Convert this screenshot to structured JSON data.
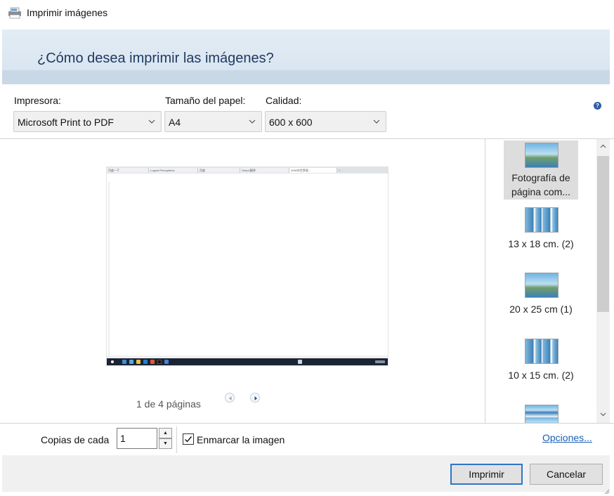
{
  "window": {
    "title": "Imprimir imágenes"
  },
  "header": {
    "title": "¿Cómo desea imprimir las imágenes?"
  },
  "printer": {
    "label": "Impresora:",
    "value": "Microsoft Print to PDF"
  },
  "paper": {
    "label": "Tamaño del papel:",
    "value": "A4"
  },
  "quality": {
    "label": "Calidad:",
    "value": "600 x 600"
  },
  "help": {
    "glyph": "?"
  },
  "preview": {
    "tabs": [
      "百度一下",
      "Logout Perceptions",
      "百度",
      "DeepL翻译",
      "2050年世界观...",
      "+"
    ],
    "pager_text": "1 de 4 páginas"
  },
  "layouts": [
    {
      "label": "Fotografía de página com...",
      "selected": true
    },
    {
      "label": "13 x 18 cm. (2)",
      "selected": false
    },
    {
      "label": "20 x 25 cm (1)",
      "selected": false
    },
    {
      "label": "10 x 15 cm. (2)",
      "selected": false
    },
    {
      "label": "",
      "selected": false
    }
  ],
  "copies": {
    "label": "Copias de cada",
    "value": "1"
  },
  "frame": {
    "label": "Enmarcar la imagen",
    "checked": true
  },
  "options_link": "Opciones...",
  "buttons": {
    "print": "Imprimir",
    "cancel": "Cancelar"
  },
  "colors": {
    "accent": "#2f75c7",
    "header_band": "#dae6f1",
    "link": "#1a5fb4"
  }
}
